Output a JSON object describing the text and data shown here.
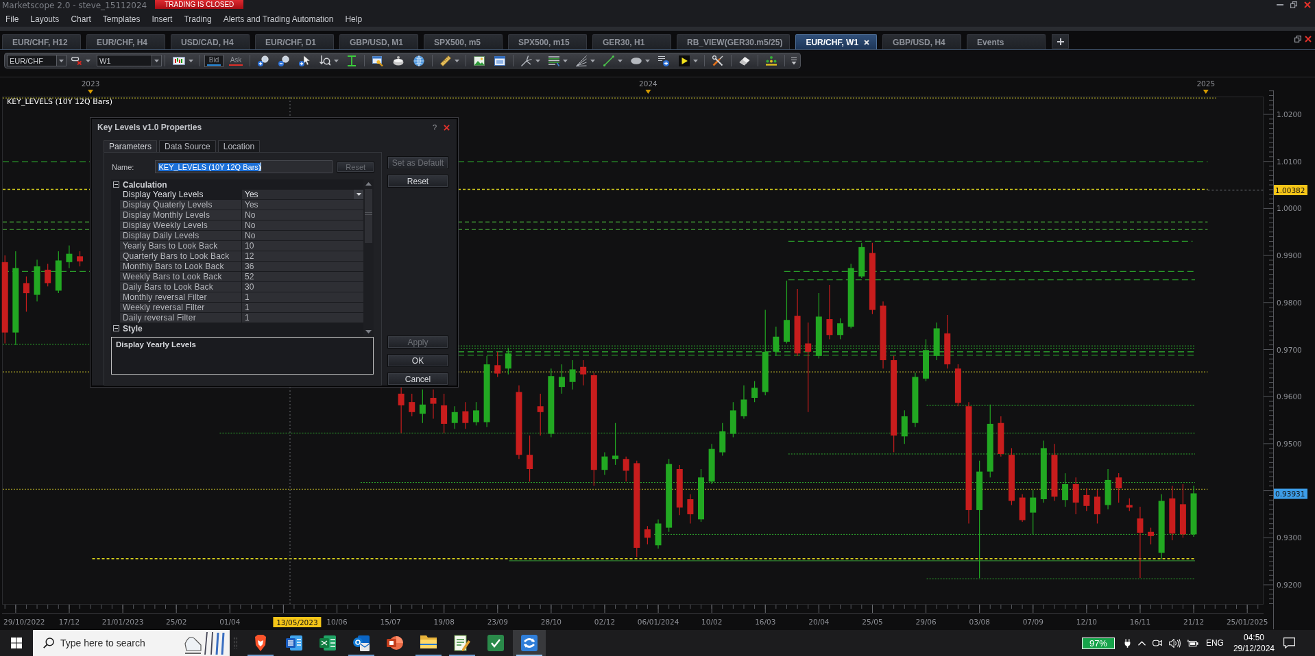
{
  "window": {
    "title": "Marketscope 2.0 - steve_15112024",
    "status_badge": "TRADING IS CLOSED"
  },
  "menu": [
    "File",
    "Layouts",
    "Chart",
    "Templates",
    "Insert",
    "Trading",
    "Alerts and Trading Automation",
    "Help"
  ],
  "tabs": [
    {
      "label": "EUR/CHF, H12",
      "selected": false
    },
    {
      "label": "EUR/CHF, H4",
      "selected": false
    },
    {
      "label": "USD/CAD, H4",
      "selected": false
    },
    {
      "label": "EUR/CHF, D1",
      "selected": false
    },
    {
      "label": "GBP/USD, M1",
      "selected": false
    },
    {
      "label": "SPX500, m5",
      "selected": false
    },
    {
      "label": "SPX500, m15",
      "selected": false
    },
    {
      "label": "GER30, H1",
      "selected": false
    },
    {
      "label": "RB_VIEW(GER30.m5/25)",
      "selected": false
    },
    {
      "label": "EUR/CHF, W1",
      "selected": true
    },
    {
      "label": "GBP/USD, H4",
      "selected": false
    },
    {
      "label": "Events",
      "selected": false
    }
  ],
  "toolbar": {
    "symbol": "EUR/CHF",
    "period": "W1",
    "price_buttons": [
      {
        "label": "Bid",
        "selected": true,
        "color": "#2a8ee0"
      },
      {
        "label": "Ask",
        "selected": false,
        "color": "#e0302a"
      }
    ]
  },
  "chart": {
    "indicator_label": "KEY_LEVELS (10Y 12Q Bars)",
    "year_labels": [
      "2023",
      "2024",
      "2025"
    ],
    "price_labels": [
      {
        "text": "1.0200",
        "kind": "tick"
      },
      {
        "text": "1.0100",
        "kind": "tick"
      },
      {
        "text": "1.0000",
        "kind": "tick"
      },
      {
        "text": "0.9900",
        "kind": "tick"
      },
      {
        "text": "0.9800",
        "kind": "tick"
      },
      {
        "text": "0.9700",
        "kind": "tick"
      },
      {
        "text": "0.9600",
        "kind": "tick"
      },
      {
        "text": "0.9500",
        "kind": "tick"
      },
      {
        "text": "0.93931",
        "kind": "last-price"
      },
      {
        "text": "0.9300",
        "kind": "tick"
      },
      {
        "text": "0.9200",
        "kind": "tick"
      }
    ],
    "level_tag": "1.00382",
    "date_labels": [
      {
        "text": "29/10/2022",
        "kind": "tick"
      },
      {
        "text": "17/12",
        "kind": "tick"
      },
      {
        "text": "21/01/2023",
        "kind": "tick"
      },
      {
        "text": "25/02",
        "kind": "tick"
      },
      {
        "text": "01/04",
        "kind": "tick"
      },
      {
        "text": "13/05/2023",
        "kind": "cursor"
      },
      {
        "text": "10/06",
        "kind": "tick"
      },
      {
        "text": "15/07",
        "kind": "tick"
      },
      {
        "text": "19/08",
        "kind": "tick"
      },
      {
        "text": "23/09",
        "kind": "tick"
      },
      {
        "text": "28/10",
        "kind": "tick"
      },
      {
        "text": "02/12",
        "kind": "tick"
      },
      {
        "text": "06/01/2024",
        "kind": "tick"
      },
      {
        "text": "10/02",
        "kind": "tick"
      },
      {
        "text": "16/03",
        "kind": "tick"
      },
      {
        "text": "20/04",
        "kind": "tick"
      },
      {
        "text": "25/05",
        "kind": "tick"
      },
      {
        "text": "29/06",
        "kind": "tick"
      },
      {
        "text": "03/08",
        "kind": "tick"
      },
      {
        "text": "07/09",
        "kind": "tick"
      },
      {
        "text": "12/10",
        "kind": "tick"
      },
      {
        "text": "16/11",
        "kind": "tick"
      },
      {
        "text": "21/12",
        "kind": "tick"
      },
      {
        "text": "25/01/2025",
        "kind": "tick"
      }
    ]
  },
  "dialog": {
    "title": "Key Levels v1.0 Properties",
    "help": "?",
    "tabs": [
      {
        "label": "Parameters",
        "selected": true
      },
      {
        "label": "Data Source",
        "selected": false
      },
      {
        "label": "Location",
        "selected": false
      }
    ],
    "name_label": "Name:",
    "name_value": "KEY_LEVELS (10Y 12Q Bars)",
    "name_reset": {
      "label": "Reset",
      "disabled": true
    },
    "sections": [
      {
        "title": "Calculation",
        "expanded": true,
        "rows": [
          {
            "name": "Display Yearly Levels",
            "value": "Yes",
            "selected": true
          },
          {
            "name": "Display Quaterly Levels",
            "value": "Yes",
            "selected": false
          },
          {
            "name": "Display Monthly Levels",
            "value": "No",
            "selected": false
          },
          {
            "name": "Display Weekly Levels",
            "value": "No",
            "selected": false
          },
          {
            "name": "Display Daily Levels",
            "value": "No",
            "selected": false
          },
          {
            "name": "Yearly Bars to Look Back",
            "value": "10",
            "selected": false
          },
          {
            "name": "Quarterly Bars to Look Back",
            "value": "12",
            "selected": false
          },
          {
            "name": "Monthly Bars to Look Back",
            "value": "36",
            "selected": false
          },
          {
            "name": "Weekly Bars to Look Back",
            "value": "52",
            "selected": false
          },
          {
            "name": "Daily Bars to Look Back",
            "value": "30",
            "selected": false
          },
          {
            "name": "Monthly reversal Filter",
            "value": "1",
            "selected": false
          },
          {
            "name": "Weekly reversal Filter",
            "value": "1",
            "selected": false
          },
          {
            "name": "Daily reversal Filter",
            "value": "1",
            "selected": false
          }
        ]
      },
      {
        "title": "Style",
        "expanded": true
      }
    ],
    "description": "Display Yearly Levels",
    "side_buttons": [
      {
        "label": "Set as Default",
        "disabled": true
      },
      {
        "label": "Reset",
        "disabled": false
      }
    ],
    "buttons": [
      {
        "label": "Apply",
        "disabled": true
      },
      {
        "label": "OK",
        "disabled": false
      },
      {
        "label": "Cancel",
        "disabled": false
      }
    ]
  },
  "taskbar": {
    "search_placeholder": "Type here to search",
    "apps": [
      {
        "running": true,
        "selected": false
      },
      {
        "running": false,
        "selected": false
      },
      {
        "running": false,
        "selected": false
      },
      {
        "running": true,
        "selected": false
      },
      {
        "running": false,
        "selected": false
      },
      {
        "running": true,
        "selected": false
      },
      {
        "running": true,
        "selected": false
      },
      {
        "running": false,
        "selected": false
      },
      {
        "running": true,
        "selected": true
      }
    ],
    "battery": "97%",
    "language": "ENG",
    "time": "04:50",
    "date": "29/12/2024"
  }
}
